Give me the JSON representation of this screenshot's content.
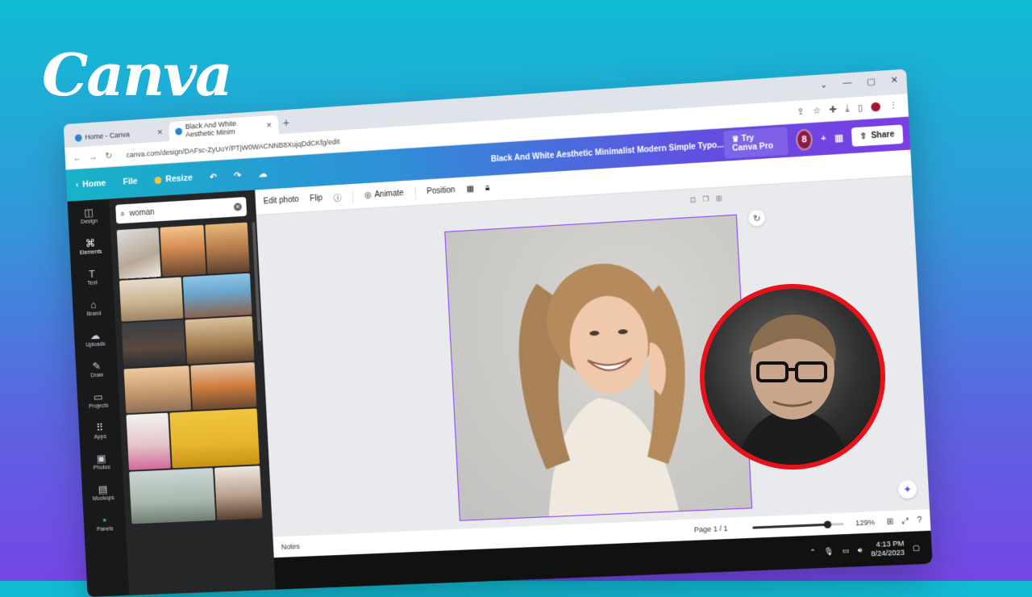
{
  "brand": {
    "logo_text": "Canva"
  },
  "browser": {
    "tabs": [
      {
        "title": "Home - Canva",
        "active": false
      },
      {
        "title": "Black And White Aesthetic Minim",
        "active": true
      }
    ],
    "url": "canva.com/design/DAFsc-ZyUoY/PTjW0WACNNB8XujqDdCKfg/edit"
  },
  "canva_header": {
    "home": "Home",
    "file": "File",
    "resize": "Resize",
    "doc_title": "Black And White Aesthetic Minimalist Modern Simple Typo...",
    "try_pro": "Try Canva Pro",
    "collaborators": "8",
    "share": "Share"
  },
  "rail": {
    "items": [
      {
        "label": "Design",
        "icon": "layout-icon"
      },
      {
        "label": "Elements",
        "icon": "shapes-icon"
      },
      {
        "label": "Text",
        "icon": "text-icon"
      },
      {
        "label": "Brand",
        "icon": "brand-icon"
      },
      {
        "label": "Uploads",
        "icon": "upload-icon"
      },
      {
        "label": "Draw",
        "icon": "pen-icon"
      },
      {
        "label": "Projects",
        "icon": "folder-icon"
      },
      {
        "label": "Apps",
        "icon": "grid-icon"
      },
      {
        "label": "Photos",
        "icon": "photo-icon"
      },
      {
        "label": "Mockups",
        "icon": "mockup-icon"
      },
      {
        "label": "Panels",
        "icon": "panels-icon"
      }
    ]
  },
  "panel": {
    "search_value": "woman"
  },
  "context_toolbar": {
    "edit_photo": "Edit photo",
    "flip": "Flip",
    "animate": "Animate",
    "position": "Position"
  },
  "footer": {
    "notes": "Notes",
    "page": "Page 1 / 1",
    "zoom": "129%",
    "zoom_fraction": 0.82
  },
  "taskbar": {
    "time": "4:13 PM",
    "date": "8/24/2023"
  },
  "colors": {
    "accent_purple": "#8b3dff",
    "webcam_ring": "#e8121b"
  }
}
